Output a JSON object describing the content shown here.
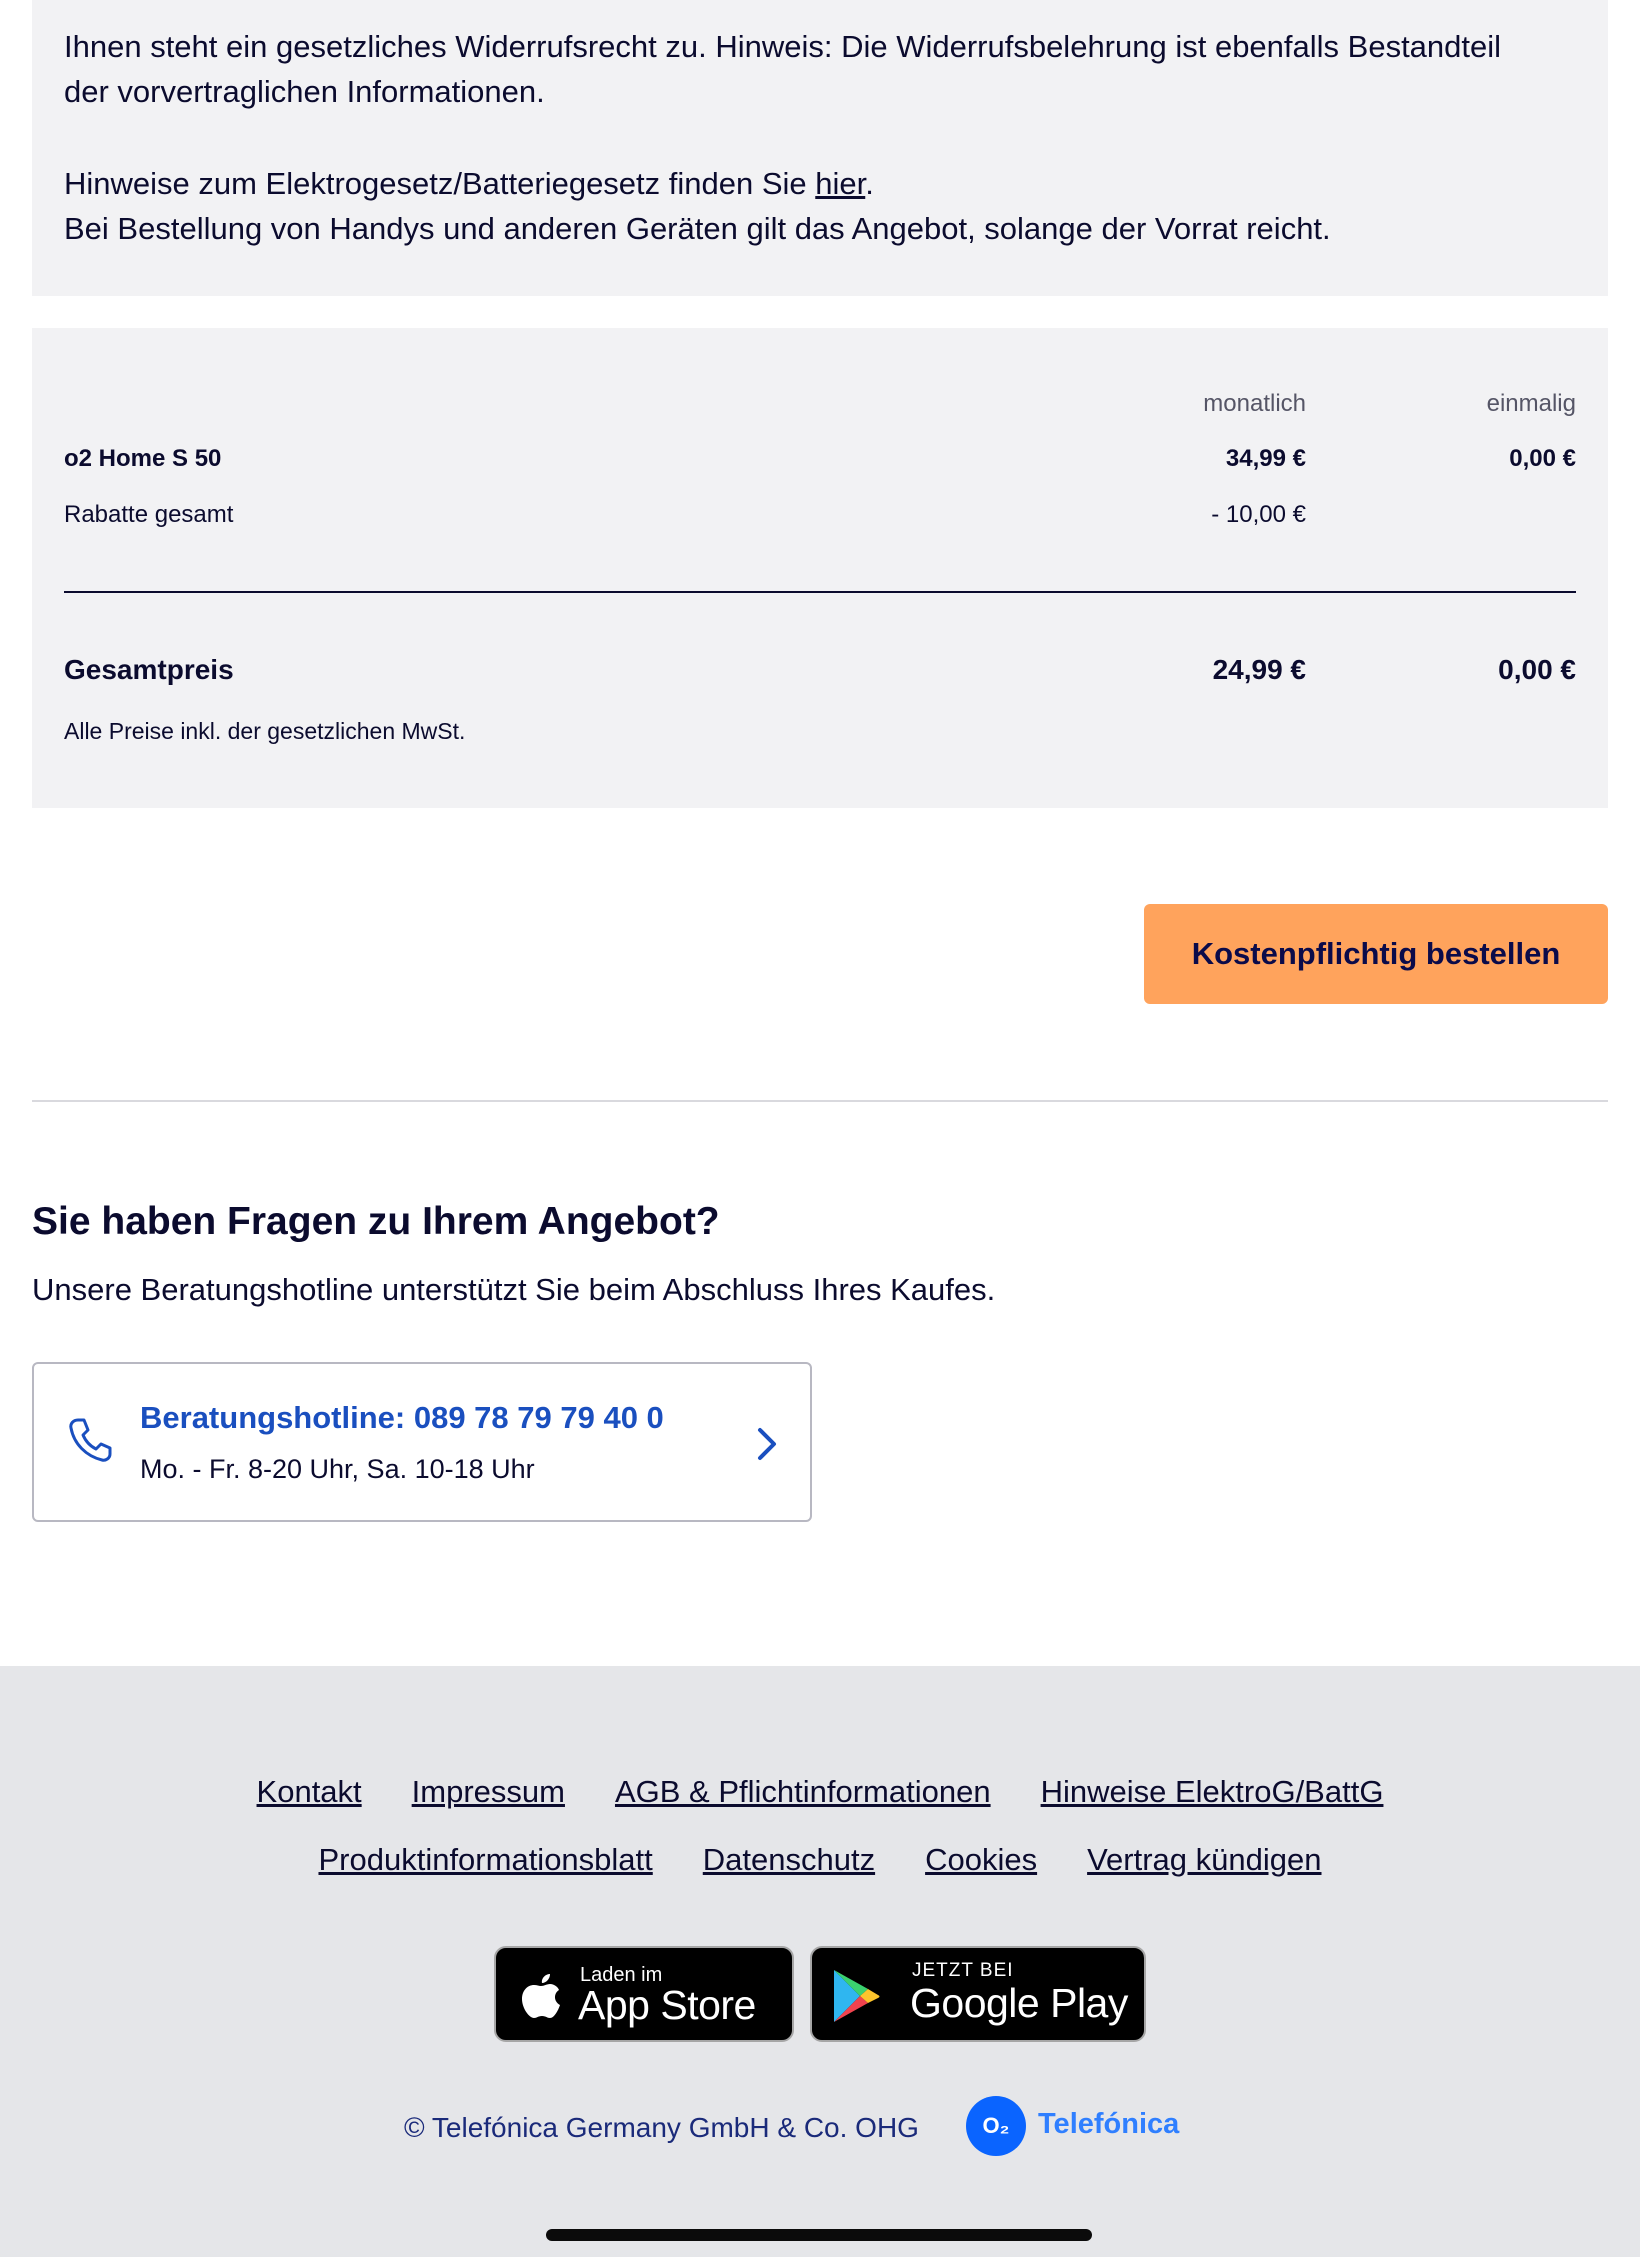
{
  "info": {
    "line1": "Ihnen steht ein gesetzliches Widerrufsrecht zu. Hinweis: Die Widerrufsbelehrung ist ebenfalls Bestandteil",
    "line2": "der vorvertraglichen Informationen.",
    "elektro_prefix": "Hinweise zum Elektrogesetz/Batteriegesetz finden Sie ",
    "elektro_link": "hier",
    "elektro_suffix": ".",
    "stock_note": "Bei Bestellung von Handys und anderen Geräten gilt das Angebot, solange der Vorrat reicht."
  },
  "price_table": {
    "col_monthly": "monatlich",
    "col_once": "einmalig",
    "rows": [
      {
        "label": "o2 Home S 50",
        "monthly": "34,99 €",
        "once": "0,00 €"
      },
      {
        "label": "Rabatte gesamt",
        "monthly": "- 10,00 €",
        "once": ""
      }
    ],
    "total_label": "Gesamtpreis",
    "total_monthly": "24,99 €",
    "total_once": "0,00 €",
    "vat_note": "Alle Preise inkl. der gesetzlichen MwSt."
  },
  "order_button_label": "Kostenpflichtig bestellen",
  "questions": {
    "title": "Sie haben Fragen zu Ihrem Angebot?",
    "subtitle": "Unsere Beratungshotline unterstützt Sie beim Abschluss Ihres Kaufes.",
    "hotline_title": "Beratungshotline: 089 78 79 79 40 0",
    "hotline_hours": "Mo. - Fr. 8-20 Uhr, Sa. 10-18 Uhr"
  },
  "footer": {
    "links_row1": [
      "Kontakt",
      "Impressum",
      "AGB & Pflichtinformationen",
      "Hinweise ElektroG/BattG"
    ],
    "links_row2": [
      "Produktinformationsblatt",
      "Datenschutz",
      "Cookies",
      "Vertrag kündigen"
    ],
    "app_store_small": "Laden im",
    "app_store_large": "App Store",
    "google_play_small": "JETZT BEI",
    "google_play_large": "Google Play",
    "copyright": "© Telefónica Germany GmbH & Co. OHG",
    "logo_mark": "O₂",
    "logo_name": "Telefónica"
  },
  "colors": {
    "accent_orange": "#ffa35c",
    "link_blue": "#1a4fbf",
    "panel_gray": "#f2f2f4",
    "footer_gray": "#e5e6e9"
  }
}
